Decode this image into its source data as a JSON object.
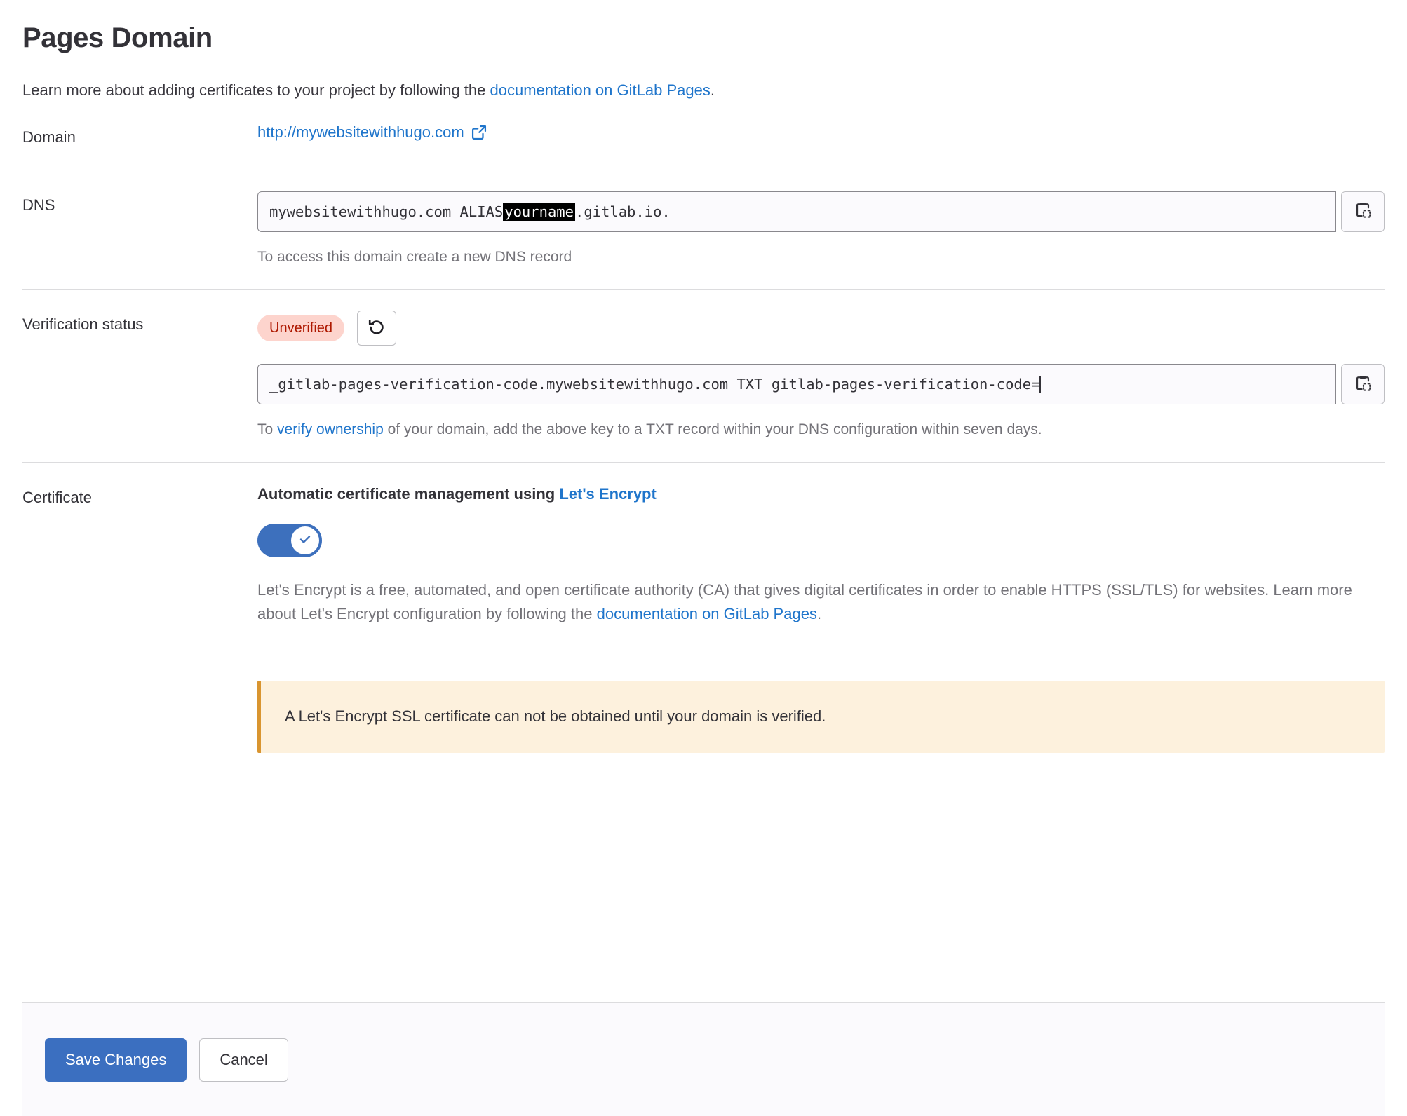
{
  "header": {
    "title": "Pages Domain",
    "subtitle_before": "Learn more about adding certificates to your project by following the ",
    "subtitle_link": "documentation on GitLab Pages",
    "subtitle_after": "."
  },
  "domain_row": {
    "label": "Domain",
    "url_text": "http://mywebsitewithhugo.com",
    "external_link_icon": "external-link-icon"
  },
  "dns_row": {
    "label": "DNS",
    "value_prefix": "mywebsitewithhugo.com ALIAS ",
    "value_highlight": "yourname",
    "value_suffix": ".gitlab.io.",
    "help_text": "To access this domain create a new DNS record",
    "copy_icon": "copy-to-clipboard-icon"
  },
  "verification_row": {
    "label": "Verification status",
    "badge": "Unverified",
    "badge_bg": "#fdd4cd",
    "badge_color": "#ae1800",
    "retry_icon": "retry-icon",
    "code_value": "_gitlab-pages-verification-code.mywebsitewithhugo.com TXT gitlab-pages-verification-code=",
    "help_before": "To ",
    "help_link": "verify ownership",
    "help_after": " of your domain, add the above key to a TXT record within your DNS configuration within seven days.",
    "copy_icon": "copy-to-clipboard-icon"
  },
  "certificate_row": {
    "label": "Certificate",
    "title_before": "Automatic certificate management using ",
    "title_link": "Let's Encrypt",
    "toggle_state": "on",
    "toggle_color": "#3d70bd",
    "description_before": "Let's Encrypt is a free, automated, and open certificate authority (CA) that gives digital certificates in order to enable HTTPS (SSL/TLS) for websites. Learn more about Let's Encrypt configuration by following the ",
    "description_link": "documentation on GitLab Pages",
    "description_after": "."
  },
  "alert": {
    "message": "A Let's Encrypt SSL certificate can not be obtained until your domain is verified.",
    "bg": "#fdf1dd",
    "border": "#d99530"
  },
  "footer": {
    "save_label": "Save Changes",
    "cancel_label": "Cancel",
    "primary_color": "#3b6fc0"
  }
}
